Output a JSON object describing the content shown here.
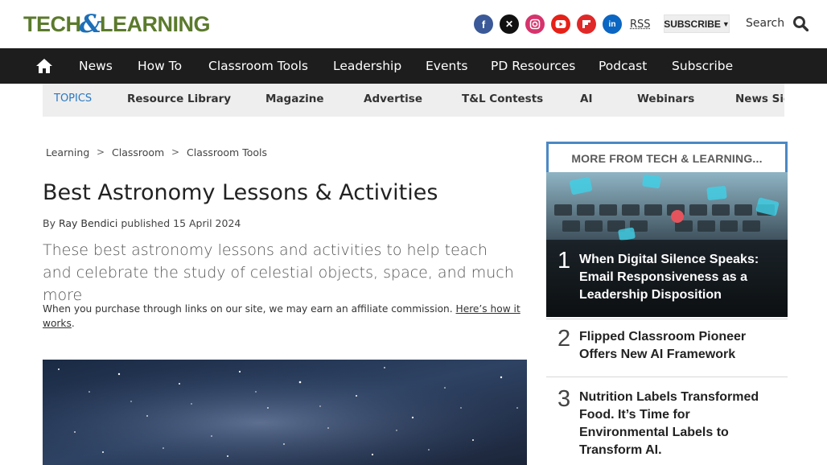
{
  "header": {
    "logo": {
      "part1": "TECH",
      "amp": "&",
      "part2": "LEARNING"
    },
    "socials": [
      {
        "name": "facebook-icon",
        "glyph": "f",
        "color": "#3b5998"
      },
      {
        "name": "x-icon",
        "glyph": "𝕏",
        "color": "#111111"
      },
      {
        "name": "instagram-icon",
        "glyph": "◎",
        "color": "#d6336c"
      },
      {
        "name": "youtube-icon",
        "glyph": "▶",
        "color": "#e62117"
      },
      {
        "name": "flipboard-icon",
        "glyph": "f",
        "color": "#e12828"
      },
      {
        "name": "linkedin-icon",
        "glyph": "in",
        "color": "#0a66c2"
      }
    ],
    "rss": "RSS",
    "subscribe_label": "SUBSCRIBE",
    "search_label": "Search"
  },
  "nav": {
    "items": [
      "News",
      "How To",
      "Classroom Tools",
      "Leadership",
      "Events",
      "PD Resources",
      "Podcast",
      "Subscribe"
    ]
  },
  "topics": {
    "label": "TOPICS",
    "items": [
      "Resource Library",
      "Magazine",
      "Advertise",
      "T&L Contests",
      "AI",
      "Webinars",
      "News Sig"
    ]
  },
  "breadcrumb": [
    "Learning",
    "Classroom",
    "Classroom Tools"
  ],
  "article": {
    "title": "Best Astronomy Lessons & Activities",
    "by": "By",
    "author": "Ray Bendici",
    "published": "published 15 April 2024",
    "standfirst": "These best astronomy lessons and activities to help teach and celebrate the study of celestial objects, space, and much more",
    "affiliate_text": "When you purchase through links on our site, we may earn an affiliate commission.",
    "affiliate_link": "Here’s how it works"
  },
  "sidebar": {
    "heading": "MORE FROM TECH & LEARNING...",
    "items": [
      {
        "num": "1",
        "text": "When Digital Silence Speaks: Email Responsiveness as a Leadership Disposition"
      },
      {
        "num": "2",
        "text": "Flipped Classroom Pioneer Offers New AI Framework"
      },
      {
        "num": "3",
        "text": "Nutrition Labels Transformed Food. It’s Time for Environmental Labels to Transform AI."
      }
    ]
  }
}
